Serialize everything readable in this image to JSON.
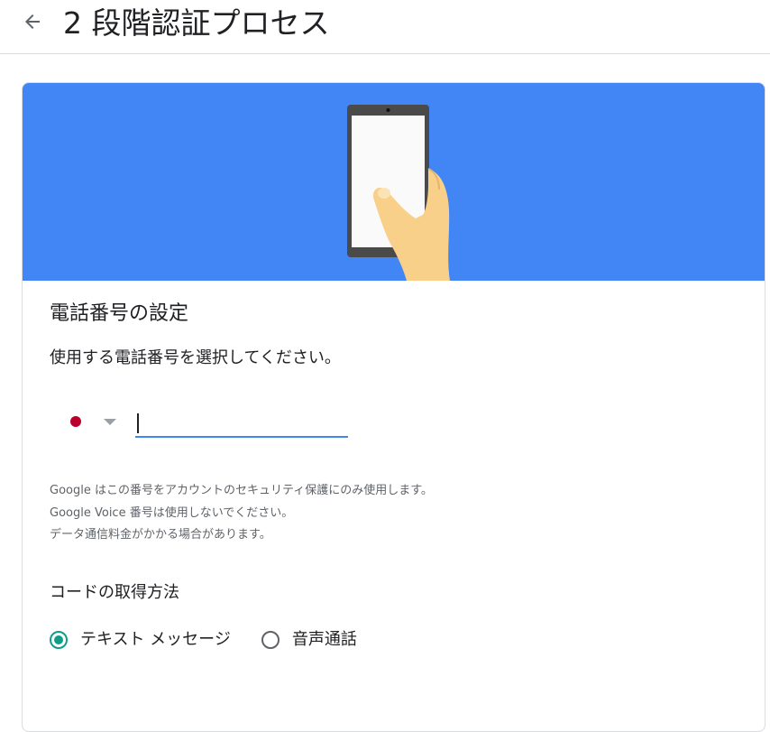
{
  "header": {
    "back_icon": "arrow-left-icon",
    "title": "2 段階認証プロセス"
  },
  "card": {
    "banner_color": "#4285f4",
    "illustration": "phone-in-hand",
    "section_title": "電話番号の設定",
    "instruction": "使用する電話番号を選択してください。",
    "phone": {
      "country": "Japan",
      "flag_color": "#bc002d",
      "value": "",
      "accent": "#4285f4"
    },
    "notes": [
      "Google はこの番号をアカウントのセキュリティ保護にのみ使用します。",
      "Google Voice 番号は使用しないでください。",
      "データ通信料金がかかる場合があります。"
    ],
    "method_title": "コードの取得方法",
    "methods": [
      {
        "label": "テキスト メッセージ",
        "checked": true
      },
      {
        "label": "音声通話",
        "checked": false
      }
    ],
    "radio_accent": "#0f9d8a"
  }
}
